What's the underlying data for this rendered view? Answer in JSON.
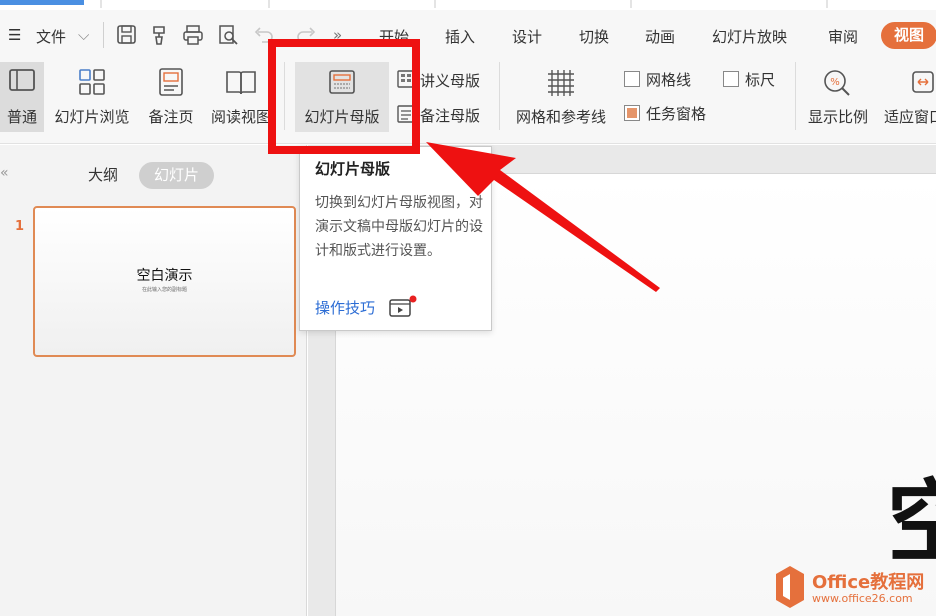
{
  "menu": {
    "file_label": "文件",
    "more_glyph": "»",
    "tabs": [
      "开始",
      "插入",
      "设计",
      "切换",
      "动画",
      "幻灯片放映",
      "审阅"
    ],
    "active_tab": "视图"
  },
  "ribbon": {
    "normal": "普通",
    "slide_sorter": "幻灯片浏览",
    "notes_page": "备注页",
    "reading_view": "阅读视图",
    "slide_master": "幻灯片母版",
    "handout_master": "讲义母版",
    "notes_master": "备注母版",
    "grid_guides": "网格和参考线",
    "gridlines": "网格线",
    "ruler": "标尺",
    "task_pane": "任务窗格",
    "zoom": "显示比例",
    "fit_window": "适应窗口"
  },
  "left_panel": {
    "collapse_glyph": "«",
    "tab_outline": "大纲",
    "tab_slides": "幻灯片",
    "slides": [
      {
        "number": "1",
        "title": "空白演示",
        "subtitle": "在此输入您的副标题"
      }
    ]
  },
  "tooltip": {
    "title": "幻灯片母版",
    "description": "切换到幻灯片母版视图，对演示文稿中母版幻灯片的设计和版式进行设置。",
    "link": "操作技巧"
  },
  "slide": {
    "visible_char": "空"
  },
  "watermark": {
    "brand": "Office教程网",
    "url": "www.office26.com"
  },
  "colors": {
    "accent": "#e5703c",
    "highlight": "#ee1111",
    "link": "#2b6cd4"
  }
}
